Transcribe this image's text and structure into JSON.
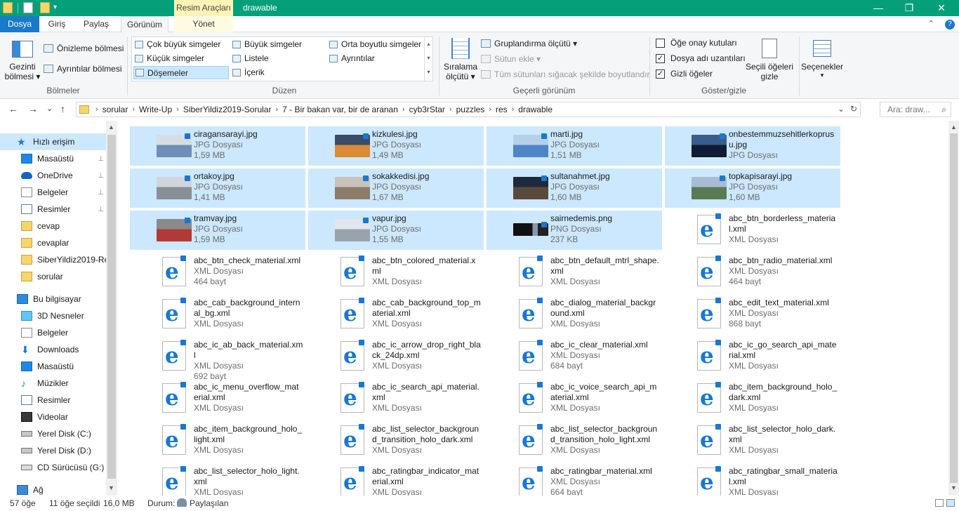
{
  "window": {
    "context_tab_header": "Resim Araçları",
    "title": "drawable",
    "minimize": "—",
    "maximize": "❐",
    "close": "✕",
    "quick_access_dropdown": "▾"
  },
  "tabs": {
    "dosya": "Dosya",
    "giris": "Giriş",
    "paylas": "Paylaş",
    "gorunum": "Görünüm",
    "yonet": "Yönet",
    "collapse": "⌃",
    "help": "?"
  },
  "ribbon": {
    "bolmeler": {
      "gezinti_line1": "Gezinti",
      "gezinti_line2": "bölmesi",
      "onizleme": "Önizleme bölmesi",
      "ayrintilar": "Ayrıntılar bölmesi",
      "group_label": "Bölmeler"
    },
    "duzen": {
      "items": {
        "cok_buyuk": "Çok büyük simgeler",
        "buyuk": "Büyük simgeler",
        "orta": "Orta boyutlu simgeler",
        "kucuk": "Küçük simgeler",
        "listele": "Listele",
        "ayrintilar": "Ayrıntılar",
        "dosemeler": "Döşemeler",
        "icerik": "İçerik"
      },
      "group_label": "Düzen"
    },
    "gecerli_gorunum": {
      "siralama_line1": "Sıralama",
      "siralama_line2": "ölçütü",
      "gruplandirma": "Gruplandırma ölçütü",
      "sutun_ekle": "Sütun ekle",
      "tum_sutunlar": "Tüm sütunları sığacak şekilde boyutlandır",
      "group_label": "Geçerli görünüm"
    },
    "goster_gizle": {
      "oge_onay": "Öğe onay kutuları",
      "dosya_adi": "Dosya adı uzantıları",
      "gizli_ogeler": "Gizli öğeler",
      "oge_onay_checked": false,
      "dosya_adi_checked": true,
      "gizli_ogeler_checked": true,
      "secili_line1": "Seçili öğeleri",
      "secili_line2": "gizle",
      "group_label": "Göster/gizle"
    },
    "secenekler": "Seçenekler"
  },
  "address": {
    "back": "←",
    "forward": "→",
    "recent": "⌄",
    "up": "↑",
    "crumbs": [
      "sorular",
      "Write-Up",
      "SiberYildiz2019-Sorular",
      "7 - Bir bakan var, bir de aranan",
      "cyb3rStar",
      "puzzles",
      "res",
      "drawable"
    ],
    "dropdown": "⌄",
    "refresh": "↻",
    "search_placeholder": "Ara: draw...",
    "search_icon": "⌕"
  },
  "nav_pane": {
    "items": [
      {
        "label": "Hızlı erişim",
        "icon": "star-icon",
        "pinned": false
      },
      {
        "label": "Masaüstü",
        "icon": "desktop-icon",
        "pinned": true
      },
      {
        "label": "OneDrive",
        "icon": "cloud-icon",
        "pinned": true
      },
      {
        "label": "Belgeler",
        "icon": "documents-icon",
        "pinned": true
      },
      {
        "label": "Resimler",
        "icon": "pictures-icon",
        "pinned": true
      },
      {
        "label": "cevap",
        "icon": "folder-icon",
        "pinned": false
      },
      {
        "label": "cevaplar",
        "icon": "folder-icon",
        "pinned": false
      },
      {
        "label": "SiberYildiz2019-Re",
        "icon": "folder-icon",
        "pinned": false
      },
      {
        "label": "sorular",
        "icon": "folder-icon",
        "pinned": false
      },
      {
        "label": "Bu bilgisayar",
        "icon": "computer-icon",
        "pinned": false
      },
      {
        "label": "3D Nesneler",
        "icon": "3d-objects-icon",
        "pinned": false
      },
      {
        "label": "Belgeler",
        "icon": "documents-icon",
        "pinned": false
      },
      {
        "label": "Downloads",
        "icon": "downloads-icon",
        "pinned": false
      },
      {
        "label": "Masaüstü",
        "icon": "desktop-icon",
        "pinned": false
      },
      {
        "label": "Müzikler",
        "icon": "music-icon",
        "pinned": false
      },
      {
        "label": "Resimler",
        "icon": "pictures-icon",
        "pinned": false
      },
      {
        "label": "Videolar",
        "icon": "videos-icon",
        "pinned": false
      },
      {
        "label": "Yerel Disk (C:)",
        "icon": "drive-icon",
        "pinned": false
      },
      {
        "label": "Yerel Disk (D:)",
        "icon": "drive-icon",
        "pinned": false
      },
      {
        "label": "CD Sürücüsü (G:)",
        "icon": "cd-drive-icon",
        "pinned": false
      },
      {
        "label": "Ağ",
        "icon": "network-icon",
        "pinned": false
      }
    ],
    "pin_glyph": "📌",
    "scroll_up": "▲",
    "scroll_down": "▼"
  },
  "files": [
    {
      "name": "ciragansarayi.jpg",
      "type": "JPG Dosyası",
      "size": "1,59 MB",
      "selected": true,
      "kind": "jpg",
      "c1": "#6f8fb8",
      "c2": "#d8dde4"
    },
    {
      "name": "kizkulesi.jpg",
      "type": "JPG Dosyası",
      "size": "1,49 MB",
      "selected": true,
      "kind": "jpg",
      "c1": "#d98b36",
      "c2": "#3d4a68"
    },
    {
      "name": "marti.jpg",
      "type": "JPG Dosyası",
      "size": "1,51 MB",
      "selected": true,
      "kind": "jpg",
      "c1": "#4f86c8",
      "c2": "#b6d0ea"
    },
    {
      "name": "onbestemmuzsehitlerkoprusu.jpg",
      "type": "JPG Dosyası",
      "size": "",
      "selected": true,
      "kind": "jpg",
      "c1": "#0f1c33",
      "c2": "#3a5d8a"
    },
    {
      "name": "ortakoy.jpg",
      "type": "JPG Dosyası",
      "size": "1,41 MB",
      "selected": true,
      "kind": "jpg",
      "c1": "#8a8f96",
      "c2": "#d2d6dc"
    },
    {
      "name": "sokakkedisi.jpg",
      "type": "JPG Dosyası",
      "size": "1,67 MB",
      "selected": true,
      "kind": "jpg",
      "c1": "#8d7b6a",
      "c2": "#c9c3bb"
    },
    {
      "name": "sultanahmet.jpg",
      "type": "JPG Dosyası",
      "size": "1,60 MB",
      "selected": true,
      "kind": "jpg",
      "c1": "#5a4a3c",
      "c2": "#1e2a3c"
    },
    {
      "name": "topkapisarayi.jpg",
      "type": "JPG Dosyası",
      "size": "1,60 MB",
      "selected": true,
      "kind": "jpg",
      "c1": "#5a7a55",
      "c2": "#a8bcd4"
    },
    {
      "name": "tramvay.jpg",
      "type": "JPG Dosyası",
      "size": "1,59 MB",
      "selected": true,
      "kind": "jpg",
      "c1": "#b13a36",
      "c2": "#8a8a8a"
    },
    {
      "name": "vapur.jpg",
      "type": "JPG Dosyası",
      "size": "1,55 MB",
      "selected": true,
      "kind": "jpg",
      "c1": "#9aa3ad",
      "c2": "#e3e6ea"
    },
    {
      "name": "sairnedemis.png",
      "type": "PNG Dosyası",
      "size": "237 KB",
      "selected": true,
      "kind": "png",
      "c1": "#111111",
      "c2": "#222222"
    },
    {
      "name": "abc_btn_borderless_material.xml",
      "type": "XML Dosyası",
      "size": "",
      "selected": false,
      "kind": "xml"
    },
    {
      "name": "abc_btn_check_material.xml",
      "type": "XML Dosyası",
      "size": "464 bayt",
      "selected": false,
      "kind": "xml"
    },
    {
      "name": "abc_btn_colored_material.xml",
      "type": "XML Dosyası",
      "size": "",
      "selected": false,
      "kind": "xml"
    },
    {
      "name": "abc_btn_default_mtrl_shape.xml",
      "type": "XML Dosyası",
      "size": "",
      "selected": false,
      "kind": "xml"
    },
    {
      "name": "abc_btn_radio_material.xml",
      "type": "XML Dosyası",
      "size": "464 bayt",
      "selected": false,
      "kind": "xml"
    },
    {
      "name": "abc_cab_background_internal_bg.xml",
      "type": "XML Dosyası",
      "size": "",
      "selected": false,
      "kind": "xml"
    },
    {
      "name": "abc_cab_background_top_material.xml",
      "type": "XML Dosyası",
      "size": "",
      "selected": false,
      "kind": "xml"
    },
    {
      "name": "abc_dialog_material_background.xml",
      "type": "XML Dosyası",
      "size": "",
      "selected": false,
      "kind": "xml"
    },
    {
      "name": "abc_edit_text_material.xml",
      "type": "XML Dosyası",
      "size": "868 bayt",
      "selected": false,
      "kind": "xml"
    },
    {
      "name": "abc_ic_ab_back_material.xml",
      "type": "XML Dosyası",
      "size": "692 bayt",
      "selected": false,
      "kind": "xml"
    },
    {
      "name": "abc_ic_arrow_drop_right_black_24dp.xml",
      "type": "XML Dosyası",
      "size": "",
      "selected": false,
      "kind": "xml"
    },
    {
      "name": "abc_ic_clear_material.xml",
      "type": "XML Dosyası",
      "size": "684 bayt",
      "selected": false,
      "kind": "xml"
    },
    {
      "name": "abc_ic_go_search_api_material.xml",
      "type": "XML Dosyası",
      "size": "",
      "selected": false,
      "kind": "xml"
    },
    {
      "name": "abc_ic_menu_overflow_material.xml",
      "type": "XML Dosyası",
      "size": "",
      "selected": false,
      "kind": "xml"
    },
    {
      "name": "abc_ic_search_api_material.xml",
      "type": "XML Dosyası",
      "size": "",
      "selected": false,
      "kind": "xml"
    },
    {
      "name": "abc_ic_voice_search_api_material.xml",
      "type": "XML Dosyası",
      "size": "",
      "selected": false,
      "kind": "xml"
    },
    {
      "name": "abc_item_background_holo_dark.xml",
      "type": "XML Dosyası",
      "size": "",
      "selected": false,
      "kind": "xml"
    },
    {
      "name": "abc_item_background_holo_light.xml",
      "type": "XML Dosyası",
      "size": "",
      "selected": false,
      "kind": "xml"
    },
    {
      "name": "abc_list_selector_background_transition_holo_dark.xml",
      "type": "XML Dosyası",
      "size": "",
      "selected": false,
      "kind": "xml"
    },
    {
      "name": "abc_list_selector_background_transition_holo_light.xml",
      "type": "XML Dosyası",
      "size": "",
      "selected": false,
      "kind": "xml"
    },
    {
      "name": "abc_list_selector_holo_dark.xml",
      "type": "XML Dosyası",
      "size": "",
      "selected": false,
      "kind": "xml"
    },
    {
      "name": "abc_list_selector_holo_light.xml",
      "type": "XML Dosyası",
      "size": "",
      "selected": false,
      "kind": "xml"
    },
    {
      "name": "abc_ratingbar_indicator_material.xml",
      "type": "XML Dosyası",
      "size": "",
      "selected": false,
      "kind": "xml"
    },
    {
      "name": "abc_ratingbar_material.xml",
      "type": "XML Dosyası",
      "size": "664 bayt",
      "selected": false,
      "kind": "xml"
    },
    {
      "name": "abc_ratingbar_small_material.xml",
      "type": "XML Dosyası",
      "size": "",
      "selected": false,
      "kind": "xml"
    }
  ],
  "scroll": {
    "up": "▲",
    "down": "▼"
  },
  "status": {
    "count": "57 öğe",
    "selected": "11 öğe seçildi",
    "selected_size": "16,0 MB",
    "state_label": "Durum:",
    "state_value": "Paylaşılan"
  },
  "colors": {
    "accent": "#05a07a",
    "selection": "#cce8ff",
    "file_tab": "#1979ca"
  }
}
